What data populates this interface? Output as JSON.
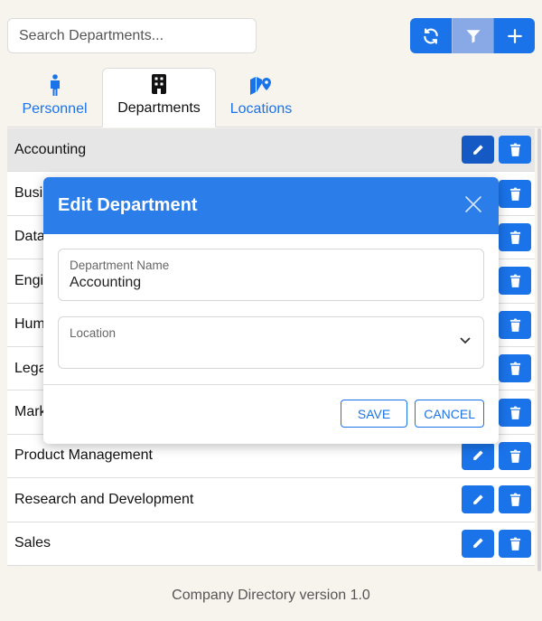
{
  "search": {
    "placeholder": "Search Departments..."
  },
  "tabs": [
    {
      "label": "Personnel",
      "icon": "person-icon"
    },
    {
      "label": "Departments",
      "icon": "building-icon"
    },
    {
      "label": "Locations",
      "icon": "map-location-icon"
    }
  ],
  "departments": [
    {
      "name": "Accounting"
    },
    {
      "name": "Business Development"
    },
    {
      "name": "Data Analysis"
    },
    {
      "name": "Engineering"
    },
    {
      "name": "Human Resources"
    },
    {
      "name": "Legal"
    },
    {
      "name": "Marketing"
    },
    {
      "name": "Product Management"
    },
    {
      "name": "Research and Development"
    },
    {
      "name": "Sales"
    }
  ],
  "modal": {
    "title": "Edit Department",
    "name_label": "Department Name",
    "name_value": "Accounting",
    "location_label": "Location",
    "location_value": "",
    "save_label": "SAVE",
    "cancel_label": "CANCEL"
  },
  "footer": {
    "text": "Company Directory version 1.0"
  },
  "colors": {
    "primary": "#1a73e8",
    "modal_header": "#2b7de9",
    "background": "#f7f4ee"
  }
}
